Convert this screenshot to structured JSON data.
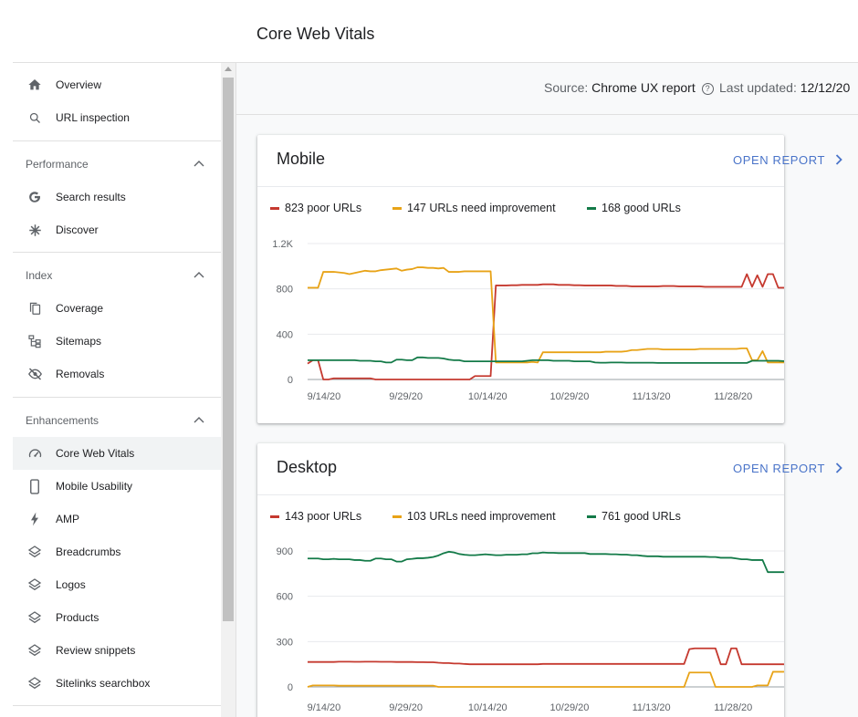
{
  "header": {
    "title": "Core Web Vitals"
  },
  "sidebar": {
    "top_items": [
      {
        "label": "Overview",
        "icon": "home-icon"
      },
      {
        "label": "URL inspection",
        "icon": "search-icon"
      }
    ],
    "sections": [
      {
        "title": "Performance",
        "items": [
          {
            "label": "Search results",
            "icon": "google-g-icon"
          },
          {
            "label": "Discover",
            "icon": "asterisk-icon"
          }
        ]
      },
      {
        "title": "Index",
        "items": [
          {
            "label": "Coverage",
            "icon": "copy-pages-icon"
          },
          {
            "label": "Sitemaps",
            "icon": "sitemap-icon"
          },
          {
            "label": "Removals",
            "icon": "eye-off-icon"
          }
        ]
      },
      {
        "title": "Enhancements",
        "items": [
          {
            "label": "Core Web Vitals",
            "icon": "speedometer-icon",
            "active": true
          },
          {
            "label": "Mobile Usability",
            "icon": "smartphone-icon"
          },
          {
            "label": "AMP",
            "icon": "lightning-icon"
          },
          {
            "label": "Breadcrumbs",
            "icon": "layers-icon"
          },
          {
            "label": "Logos",
            "icon": "layers-icon"
          },
          {
            "label": "Products",
            "icon": "layers-icon"
          },
          {
            "label": "Review snippets",
            "icon": "layers-icon"
          },
          {
            "label": "Sitelinks searchbox",
            "icon": "layers-icon"
          }
        ]
      }
    ]
  },
  "source_bar": {
    "source_label": "Source:",
    "source_value": "Chrome UX report",
    "updated_label": "Last updated:",
    "updated_value": "12/12/20"
  },
  "colors": {
    "poor": "#c5392f",
    "needs_improvement": "#e8a317",
    "good": "#137a48",
    "link": "#4a74c9"
  },
  "cards": [
    {
      "title": "Mobile",
      "open_report": "OPEN REPORT",
      "legend": [
        {
          "label": "823 poor URLs",
          "key": "poor"
        },
        {
          "label": "147 URLs need improvement",
          "key": "needs_improvement"
        },
        {
          "label": "168 good URLs",
          "key": "good"
        }
      ],
      "chart_data": {
        "type": "line",
        "x_start": "2020-09-11",
        "x_end": "2020-12-12",
        "x_ticks": [
          "9/14/20",
          "9/29/20",
          "10/14/20",
          "10/29/20",
          "11/13/20",
          "11/28/20"
        ],
        "y_ticks": [
          "0",
          "400",
          "800",
          "1.2K"
        ],
        "y_tick_values": [
          0,
          400,
          800,
          1200
        ],
        "ylim": [
          0,
          1200
        ],
        "series": [
          {
            "name": "823 poor URLs",
            "key": "poor",
            "values": [
              140,
              170,
              170,
              0,
              0,
              10,
              10,
              10,
              10,
              10,
              10,
              10,
              10,
              0,
              0,
              0,
              0,
              0,
              0,
              0,
              0,
              0,
              0,
              0,
              0,
              0,
              0,
              0,
              0,
              0,
              0,
              0,
              30,
              30,
              30,
              30,
              830,
              830,
              830,
              832,
              832,
              835,
              835,
              835,
              835,
              840,
              840,
              840,
              835,
              835,
              835,
              832,
              832,
              830,
              830,
              830,
              830,
              830,
              830,
              826,
              826,
              826,
              822,
              822,
              822,
              822,
              822,
              822,
              825,
              825,
              825,
              822,
              822,
              822,
              822,
              822,
              818,
              818,
              818,
              818,
              818,
              818,
              818,
              818,
              930,
              818,
              920,
              818,
              930,
              930,
              810,
              810,
              810,
              810,
              810,
              810,
              823
            ]
          },
          {
            "name": "147 URLs need improvement",
            "key": "needs_improvement",
            "values": [
              810,
              810,
              810,
              950,
              950,
              950,
              945,
              940,
              930,
              940,
              950,
              960,
              955,
              955,
              965,
              970,
              975,
              980,
              960,
              970,
              975,
              990,
              990,
              985,
              985,
              980,
              985,
              950,
              950,
              950,
              955,
              955,
              955,
              955,
              955,
              955,
              150,
              150,
              150,
              150,
              150,
              150,
              150,
              155,
              150,
              240,
              240,
              240,
              240,
              240,
              240,
              240,
              240,
              240,
              240,
              240,
              240,
              245,
              245,
              245,
              245,
              250,
              260,
              260,
              265,
              270,
              270,
              270,
              265,
              265,
              265,
              265,
              265,
              265,
              265,
              270,
              270,
              270,
              270,
              270,
              270,
              270,
              270,
              275,
              275,
              170,
              170,
              250,
              150,
              150,
              150,
              150,
              148,
              148,
              148,
              148,
              147
            ]
          },
          {
            "name": "168 good URLs",
            "key": "good",
            "values": [
              170,
              170,
              170,
              170,
              170,
              170,
              170,
              170,
              170,
              170,
              165,
              165,
              165,
              160,
              160,
              150,
              150,
              175,
              175,
              170,
              170,
              195,
              195,
              190,
              190,
              190,
              185,
              175,
              170,
              170,
              160,
              160,
              160,
              160,
              160,
              160,
              160,
              160,
              160,
              160,
              160,
              160,
              165,
              170,
              170,
              170,
              170,
              165,
              165,
              165,
              165,
              160,
              160,
              160,
              160,
              150,
              148,
              148,
              150,
              150,
              150,
              148,
              148,
              148,
              148,
              148,
              148,
              146,
              146,
              146,
              146,
              146,
              146,
              146,
              146,
              146,
              146,
              146,
              146,
              146,
              146,
              146,
              146,
              146,
              146,
              165,
              165,
              165,
              165,
              165,
              165,
              162,
              162,
              162,
              165,
              165,
              168
            ]
          }
        ]
      }
    },
    {
      "title": "Desktop",
      "open_report": "OPEN REPORT",
      "legend": [
        {
          "label": "143 poor URLs",
          "key": "poor"
        },
        {
          "label": "103 URLs need improvement",
          "key": "needs_improvement"
        },
        {
          "label": "761 good URLs",
          "key": "good"
        }
      ],
      "chart_data": {
        "type": "line",
        "x_start": "2020-09-11",
        "x_end": "2020-12-12",
        "x_ticks": [
          "9/14/20",
          "9/29/20",
          "10/14/20",
          "10/29/20",
          "11/13/20",
          "11/28/20"
        ],
        "y_ticks": [
          "0",
          "300",
          "600",
          "900"
        ],
        "y_tick_values": [
          0,
          300,
          600,
          900
        ],
        "ylim": [
          0,
          900
        ],
        "series": [
          {
            "name": "143 poor URLs",
            "key": "poor",
            "values": [
              165,
              165,
              165,
              165,
              165,
              165,
              167,
              167,
              167,
              166,
              166,
              167,
              167,
              167,
              166,
              166,
              166,
              165,
              165,
              165,
              165,
              164,
              164,
              163,
              163,
              160,
              158,
              158,
              155,
              155,
              152,
              150,
              150,
              150,
              150,
              150,
              150,
              150,
              150,
              150,
              150,
              150,
              150,
              150,
              150,
              152,
              152,
              152,
              152,
              152,
              152,
              152,
              152,
              152,
              152,
              152,
              152,
              152,
              152,
              152,
              152,
              152,
              152,
              152,
              152,
              152,
              152,
              152,
              152,
              152,
              152,
              152,
              152,
              250,
              255,
              255,
              255,
              255,
              255,
              150,
              150,
              255,
              255,
              150,
              150,
              150,
              150,
              150,
              150,
              150,
              150,
              150,
              140,
              140,
              140,
              140,
              143
            ]
          },
          {
            "name": "103 URLs need improvement",
            "key": "needs_improvement",
            "values": [
              0,
              10,
              10,
              10,
              10,
              10,
              8,
              8,
              8,
              8,
              8,
              8,
              8,
              8,
              8,
              8,
              8,
              8,
              8,
              8,
              8,
              8,
              8,
              8,
              8,
              0,
              0,
              0,
              0,
              0,
              0,
              0,
              0,
              0,
              0,
              0,
              0,
              0,
              0,
              0,
              0,
              0,
              0,
              0,
              0,
              0,
              0,
              0,
              0,
              0,
              0,
              0,
              0,
              0,
              0,
              0,
              0,
              0,
              0,
              0,
              0,
              0,
              0,
              0,
              0,
              0,
              0,
              0,
              0,
              0,
              0,
              0,
              0,
              95,
              95,
              95,
              95,
              95,
              0,
              0,
              0,
              0,
              0,
              0,
              0,
              0,
              10,
              10,
              10,
              100,
              100,
              100,
              105,
              105,
              105,
              105,
              103
            ]
          },
          {
            "name": "761 good URLs",
            "key": "good",
            "values": [
              850,
              850,
              850,
              845,
              845,
              848,
              845,
              845,
              845,
              840,
              840,
              835,
              835,
              850,
              850,
              845,
              845,
              830,
              830,
              845,
              848,
              852,
              852,
              855,
              860,
              870,
              885,
              895,
              890,
              880,
              875,
              872,
              872,
              875,
              878,
              875,
              872,
              872,
              875,
              875,
              875,
              878,
              878,
              885,
              885,
              890,
              888,
              888,
              886,
              886,
              886,
              886,
              886,
              886,
              880,
              880,
              880,
              880,
              878,
              878,
              876,
              876,
              872,
              872,
              868,
              865,
              865,
              865,
              862,
              862,
              862,
              862,
              862,
              862,
              862,
              862,
              862,
              860,
              860,
              855,
              855,
              855,
              850,
              845,
              845,
              840,
              840,
              840,
              760,
              760,
              760,
              760,
              758,
              758,
              758,
              758,
              761
            ]
          }
        ]
      }
    }
  ]
}
